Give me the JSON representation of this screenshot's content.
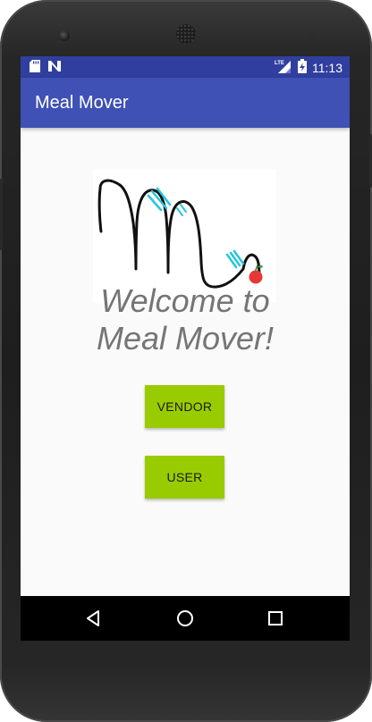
{
  "status_bar": {
    "time": "11:13",
    "network_type": "LTE",
    "icons": [
      "sd-card-icon",
      "notification-n-icon",
      "lte-signal-icon",
      "battery-charging-icon"
    ]
  },
  "app_bar": {
    "title": "Meal Mover"
  },
  "logo": {
    "icon": "meal-mover-logo",
    "accent_color": "#26c6da",
    "apple_color": "#e53935"
  },
  "welcome": {
    "line1": "Welcome to",
    "line2": "Meal Mover!"
  },
  "buttons": {
    "vendor_label": "VENDOR",
    "user_label": "USER",
    "color": "#99cc00"
  },
  "nav_bar": {
    "icons": [
      "back-icon",
      "home-icon",
      "recents-icon"
    ]
  },
  "colors": {
    "status_bar": "#303f9f",
    "app_bar": "#3f51b5",
    "background": "#fafafa"
  }
}
